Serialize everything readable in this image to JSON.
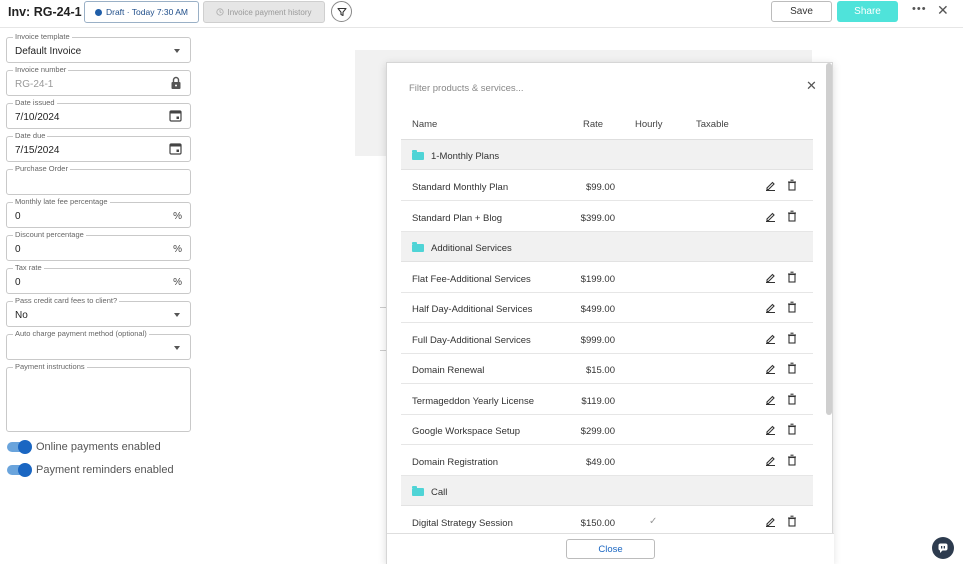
{
  "header": {
    "invoice_title": "Inv: RG-24-1",
    "draft_status": "Draft · Today 7:30 AM",
    "history_label": "Invoice payment history",
    "save_label": "Save",
    "share_label": "Share",
    "more_label": "•••",
    "close_label": "✕"
  },
  "form": {
    "invoice_template": {
      "label": "Invoice template",
      "value": "Default Invoice"
    },
    "invoice_number": {
      "label": "Invoice number",
      "value": "RG-24-1"
    },
    "date_issued": {
      "label": "Date issued",
      "value": "7/10/2024"
    },
    "date_due": {
      "label": "Date due",
      "value": "7/15/2024"
    },
    "purchase_order": {
      "label": "Purchase Order",
      "value": ""
    },
    "late_fee": {
      "label": "Monthly late fee percentage",
      "value": "0",
      "unit": "%"
    },
    "discount": {
      "label": "Discount percentage",
      "value": "0",
      "unit": "%"
    },
    "tax_rate": {
      "label": "Tax rate",
      "value": "0",
      "unit": "%"
    },
    "pass_fees": {
      "label": "Pass credit card fees to client?",
      "value": "No"
    },
    "auto_charge": {
      "label": "Auto charge payment method (optional)",
      "value": ""
    },
    "payment_instructions": {
      "label": "Payment instructions",
      "value": ""
    },
    "online_payments": {
      "label": "Online payments enabled",
      "enabled": true
    },
    "payment_reminders": {
      "label": "Payment reminders enabled",
      "enabled": true
    }
  },
  "modal": {
    "filter_placeholder": "Filter products & services...",
    "close_x": "✕",
    "columns": {
      "name": "Name",
      "rate": "Rate",
      "hourly": "Hourly",
      "taxable": "Taxable"
    },
    "groups": [
      {
        "name": "1-Monthly Plans"
      },
      {
        "name": "Additional Services"
      },
      {
        "name": "Call"
      }
    ],
    "items": [
      {
        "name": "Standard Monthly Plan",
        "rate": "$99.00",
        "hourly": ""
      },
      {
        "name": "Standard Plan + Blog",
        "rate": "$399.00",
        "hourly": ""
      },
      {
        "name": "Flat Fee-Additional Services",
        "rate": "$199.00",
        "hourly": ""
      },
      {
        "name": "Half Day-Additional Services",
        "rate": "$499.00",
        "hourly": ""
      },
      {
        "name": "Full Day-Additional Services",
        "rate": "$999.00",
        "hourly": ""
      },
      {
        "name": "Domain Renewal",
        "rate": "$15.00",
        "hourly": ""
      },
      {
        "name": "Termageddon Yearly License",
        "rate": "$119.00",
        "hourly": ""
      },
      {
        "name": "Google Workspace Setup",
        "rate": "$299.00",
        "hourly": ""
      },
      {
        "name": "Domain Registration",
        "rate": "$49.00",
        "hourly": ""
      },
      {
        "name": "Digital Strategy Session",
        "rate": "$150.00",
        "hourly": "✓"
      }
    ],
    "close_button": "Close"
  },
  "colors": {
    "accent": "#4fe3da",
    "primary": "#1a66c2",
    "folder": "#4fd4d6"
  }
}
